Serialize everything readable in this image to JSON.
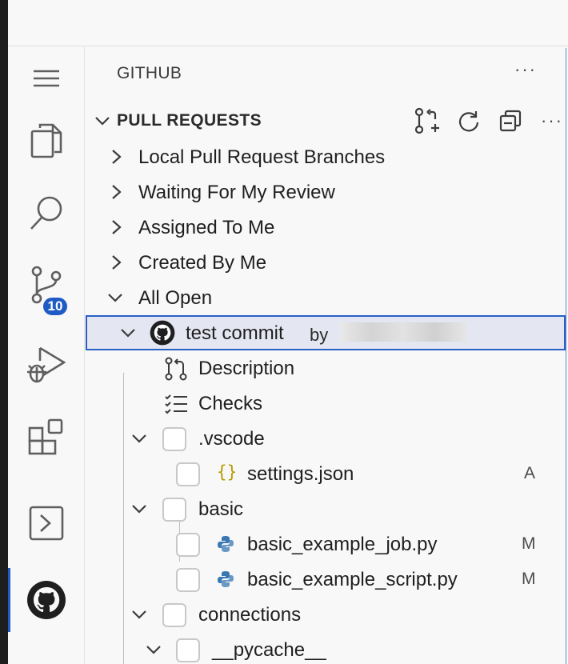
{
  "view": {
    "title": "GITHUB",
    "more": "···"
  },
  "section": {
    "label": "PULL REQUESTS",
    "more": "···"
  },
  "activity": {
    "source_control_badge": "10"
  },
  "categories": [
    {
      "label": "Local Pull Request Branches"
    },
    {
      "label": "Waiting For My Review"
    },
    {
      "label": "Assigned To Me"
    },
    {
      "label": "Created By Me"
    },
    {
      "label": "All Open"
    }
  ],
  "pr": {
    "title": "test commit",
    "by": "by"
  },
  "pr_children": {
    "description": "Description",
    "checks": "Checks"
  },
  "files": [
    {
      "label": ".vscode"
    },
    {
      "label": "settings.json",
      "status": "A"
    },
    {
      "label": "basic"
    },
    {
      "label": "basic_example_job.py",
      "status": "M"
    },
    {
      "label": "basic_example_script.py",
      "status": "M"
    },
    {
      "label": "connections"
    },
    {
      "label": "__pycache__"
    }
  ],
  "colors": {
    "accent": "#1f5bc4",
    "json_icon": "#b59b00",
    "python_icon": "#3a78b3"
  }
}
